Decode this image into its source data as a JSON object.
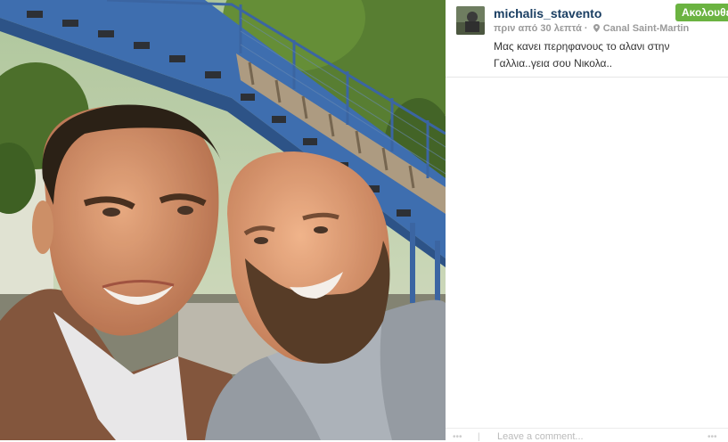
{
  "post": {
    "username": "michalis_stavento",
    "time": "πριν από 30 λεπτά",
    "location": "Canal Saint-Martin",
    "follow_label": "Ακολουθείτε",
    "caption": "Μας κανει περηφανους το αλανι στην Γαλλια..γεια σου Νικολα..",
    "comment_placeholder": "Leave a comment..."
  },
  "colors": {
    "username": "#1b3f63",
    "follow_button": "#6bb341",
    "meta_text": "#9b9b9b"
  },
  "icons": {
    "location": "map-pin-icon"
  }
}
